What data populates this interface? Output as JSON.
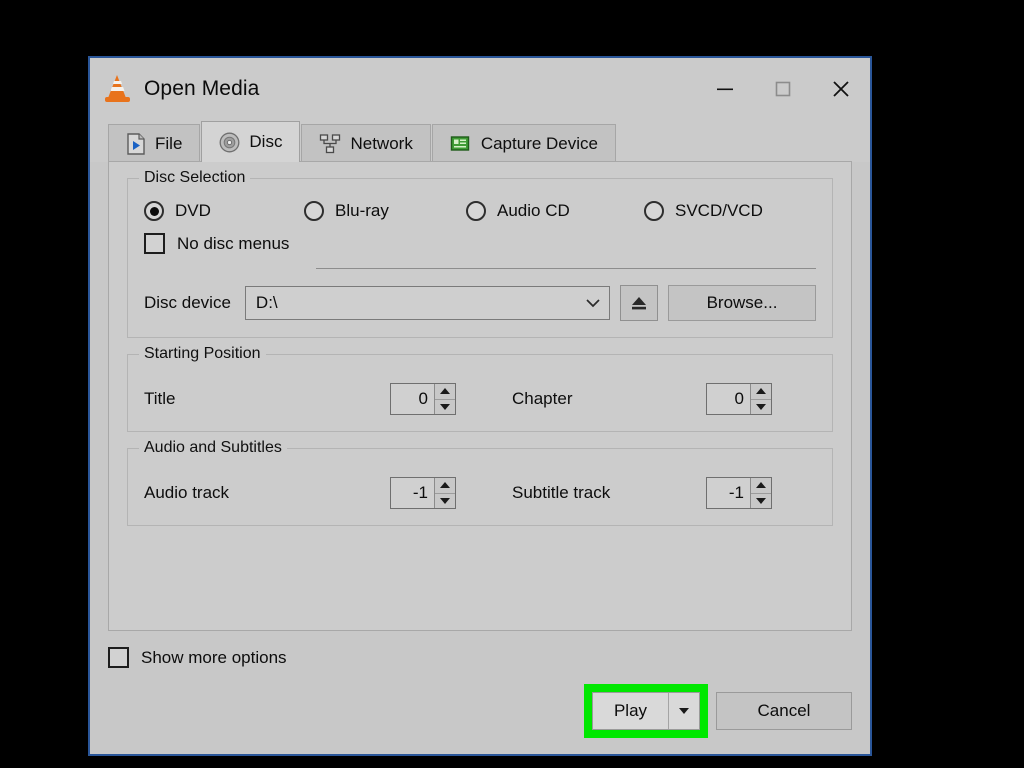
{
  "window": {
    "title": "Open Media",
    "app_icon": "vlc-cone-icon",
    "controls": {
      "minimize": "minimize-icon",
      "maximize": "maximize-icon",
      "close": "close-icon"
    }
  },
  "tabs": [
    {
      "label": "File",
      "icon": "file-play-icon",
      "active": false
    },
    {
      "label": "Disc",
      "icon": "disc-icon",
      "active": true
    },
    {
      "label": "Network",
      "icon": "network-icon",
      "active": false
    },
    {
      "label": "Capture Device",
      "icon": "capture-device-icon",
      "active": false
    }
  ],
  "disc_selection": {
    "legend": "Disc Selection",
    "options": [
      {
        "label": "DVD",
        "selected": true
      },
      {
        "label": "Blu-ray",
        "selected": false
      },
      {
        "label": "Audio CD",
        "selected": false
      },
      {
        "label": "SVCD/VCD",
        "selected": false
      }
    ],
    "no_disc_menus": {
      "label": "No disc menus",
      "checked": false
    },
    "disc_device": {
      "label": "Disc device",
      "value": "D:\\",
      "dropdown_icon": "chevron-down-icon",
      "eject_icon": "eject-icon",
      "browse_label": "Browse..."
    }
  },
  "starting_position": {
    "legend": "Starting Position",
    "title": {
      "label": "Title",
      "value": "0"
    },
    "chapter": {
      "label": "Chapter",
      "value": "0"
    }
  },
  "audio_subtitles": {
    "legend": "Audio and Subtitles",
    "audio_track": {
      "label": "Audio track",
      "value": "-1"
    },
    "subtitle_track": {
      "label": "Subtitle track",
      "value": "-1"
    }
  },
  "footer": {
    "show_more_options": {
      "label": "Show more options",
      "checked": false
    },
    "play_label": "Play",
    "play_dropdown_icon": "triangle-down-icon",
    "cancel_label": "Cancel"
  },
  "colors": {
    "highlight_green": "#00e800",
    "window_border_blue": "#2a5699",
    "dialog_background": "#c8c8c8",
    "page_background": "#000000"
  }
}
